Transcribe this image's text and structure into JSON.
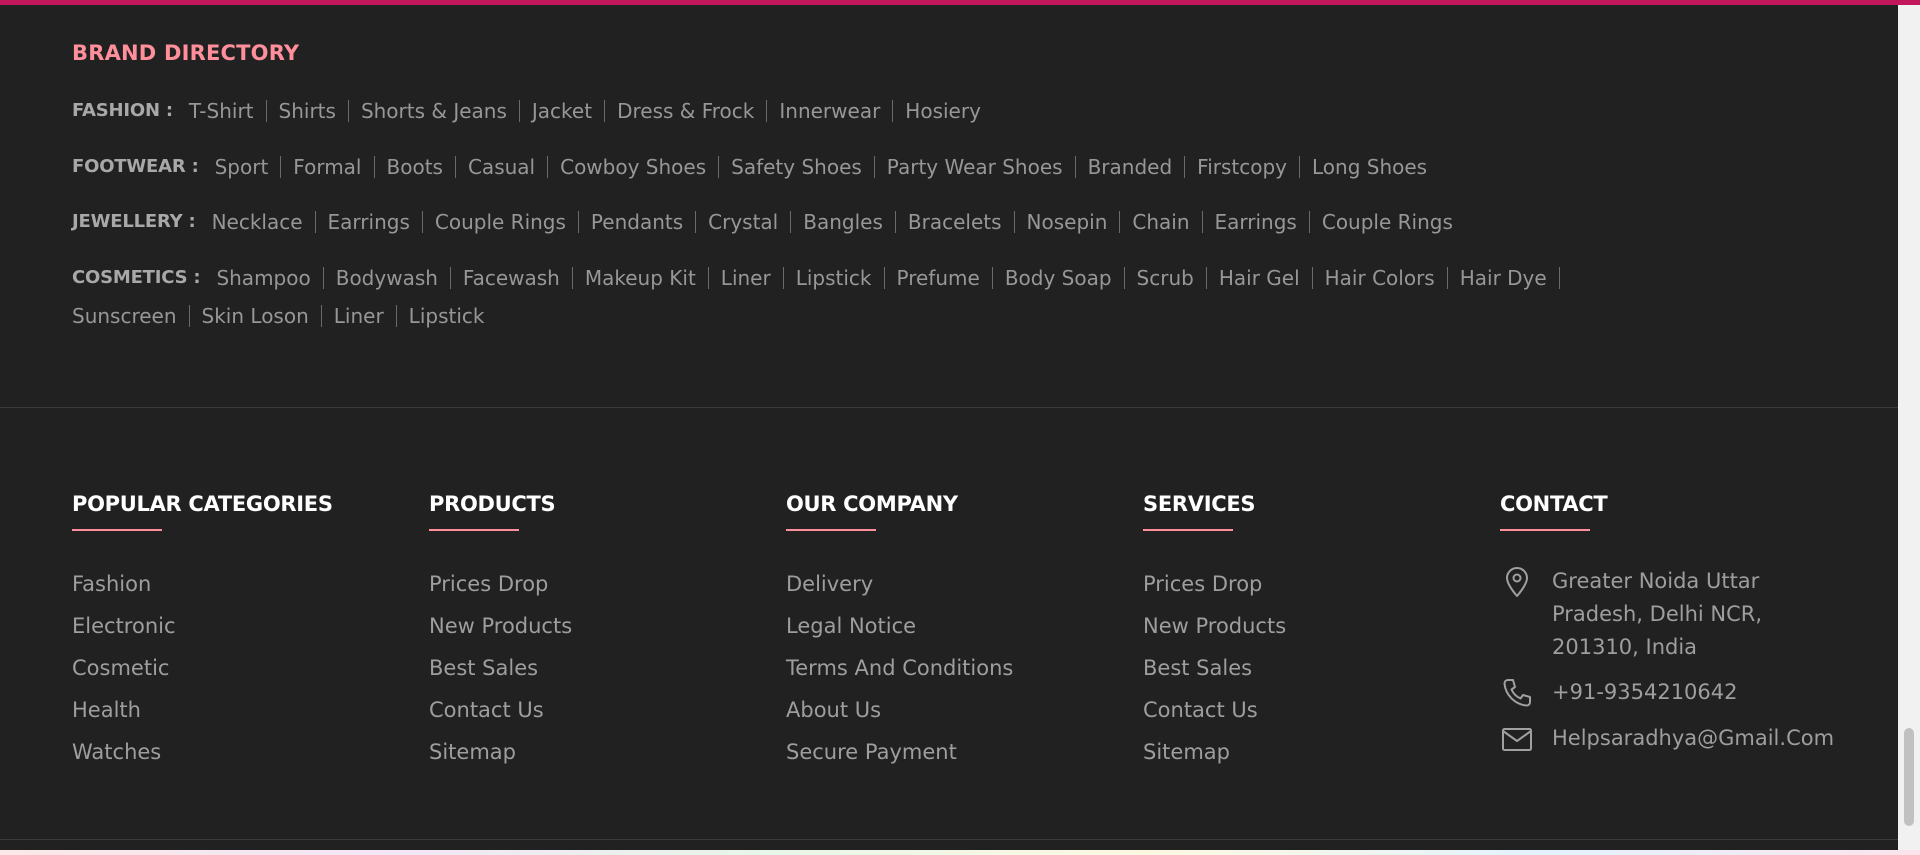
{
  "brand_directory": {
    "title": "BRAND DIRECTORY",
    "rows": [
      {
        "label": "FASHION :",
        "items": [
          "T-Shirt",
          "Shirts",
          "Shorts & Jeans",
          "Jacket",
          "Dress & Frock",
          "Innerwear",
          "Hosiery"
        ]
      },
      {
        "label": "FOOTWEAR :",
        "items": [
          "Sport",
          "Formal",
          "Boots",
          "Casual",
          "Cowboy Shoes",
          "Safety Shoes",
          "Party Wear Shoes",
          "Branded",
          "Firstcopy",
          "Long Shoes"
        ]
      },
      {
        "label": "JEWELLERY :",
        "items": [
          "Necklace",
          "Earrings",
          "Couple Rings",
          "Pendants",
          "Crystal",
          "Bangles",
          "Bracelets",
          "Nosepin",
          "Chain",
          "Earrings",
          "Couple Rings"
        ]
      },
      {
        "label": "COSMETICS :",
        "items": [
          "Shampoo",
          "Bodywash",
          "Facewash",
          "Makeup Kit",
          "Liner",
          "Lipstick",
          "Prefume",
          "Body Soap",
          "Scrub",
          "Hair Gel",
          "Hair Colors",
          "Hair Dye",
          "Sunscreen",
          "Skin Loson",
          "Liner",
          "Lipstick"
        ]
      }
    ]
  },
  "columns": [
    {
      "title": "POPULAR CATEGORIES",
      "items": [
        "Fashion",
        "Electronic",
        "Cosmetic",
        "Health",
        "Watches"
      ]
    },
    {
      "title": "PRODUCTS",
      "items": [
        "Prices Drop",
        "New Products",
        "Best Sales",
        "Contact Us",
        "Sitemap"
      ]
    },
    {
      "title": "OUR COMPANY",
      "items": [
        "Delivery",
        "Legal Notice",
        "Terms And Conditions",
        "About Us",
        "Secure Payment"
      ]
    },
    {
      "title": "SERVICES",
      "items": [
        "Prices Drop",
        "New Products",
        "Best Sales",
        "Contact Us",
        "Sitemap"
      ]
    }
  ],
  "contact": {
    "title": "CONTACT",
    "address": "Greater Noida Uttar Pradesh, Delhi NCR, 201310, India",
    "phone": "+91-9354210642",
    "email": "Helpsaradhya@Gmail.Com"
  },
  "icons": {
    "address": "location-pin-icon",
    "phone": "phone-icon",
    "email": "mail-icon"
  },
  "colors": {
    "background": "#212121",
    "accent": "#ff8f9a",
    "top_bar": "#c2185b",
    "text_muted": "#9e9e9e",
    "heading": "#ffffff"
  }
}
